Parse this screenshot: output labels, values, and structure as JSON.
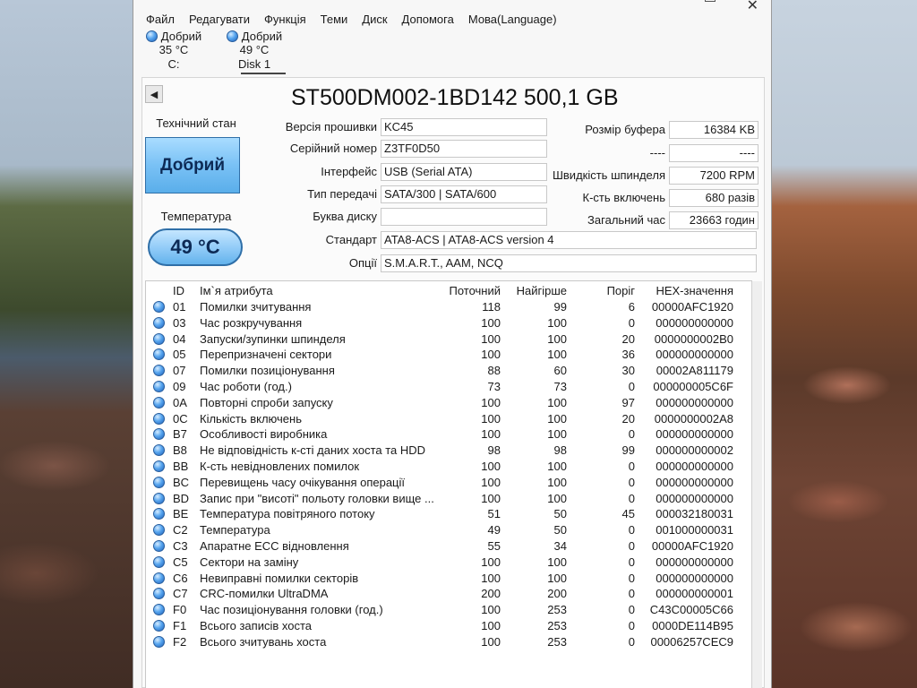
{
  "window": {
    "close_glyph": "✕"
  },
  "menu": [
    "Файл",
    "Редагувати",
    "Функція",
    "Теми",
    "Диск",
    "Допомога",
    "Мова(Language)"
  ],
  "disks": [
    {
      "status": "Добрий",
      "temp": "35 °C",
      "label": "C:"
    },
    {
      "status": "Добрий",
      "temp": "49 °C",
      "label": "Disk 1"
    }
  ],
  "disk_title": "ST500DM002-1BD142 500,1 GB",
  "health": {
    "label": "Технічний стан",
    "value": "Добрий"
  },
  "temperature": {
    "label": "Температура",
    "value": "49 °C"
  },
  "fields": {
    "firmware": {
      "label": "Версія прошивки",
      "value": "KC45"
    },
    "serial": {
      "label": "Серійний номер",
      "value": "Z3TF0D50"
    },
    "interface": {
      "label": "Інтерфейс",
      "value": "USB (Serial ATA)"
    },
    "transfer": {
      "label": "Тип передачі",
      "value": "SATA/300 | SATA/600"
    },
    "letter": {
      "label": "Буква диску",
      "value": ""
    },
    "standard": {
      "label": "Стандарт",
      "value": "ATA8-ACS | ATA8-ACS version 4"
    },
    "features": {
      "label": "Опції",
      "value": "S.M.A.R.T., AAM, NCQ"
    },
    "buffer": {
      "label": "Розмір буфера",
      "value": "16384 KB"
    },
    "blank": {
      "label": "----",
      "value": "----"
    },
    "rotation": {
      "label": "Швидкість шпинделя",
      "value": "7200 RPM"
    },
    "power_count": {
      "label": "К-сть включень",
      "value": "680 разів"
    },
    "power_hours": {
      "label": "Загальний час",
      "value": "23663 годин"
    }
  },
  "smart": {
    "headers": {
      "id": "ID",
      "name": "Ім`я атрибута",
      "current": "Поточний",
      "worst": "Найгірше",
      "threshold": "Поріг",
      "raw": "HEX-значення"
    },
    "rows": [
      {
        "id": "01",
        "name": "Помилки зчитування",
        "current": "118",
        "worst": "99",
        "threshold": "6",
        "raw": "00000AFC1920"
      },
      {
        "id": "03",
        "name": "Час розкручування",
        "current": "100",
        "worst": "100",
        "threshold": "0",
        "raw": "000000000000"
      },
      {
        "id": "04",
        "name": "Запуски/зупинки шпинделя",
        "current": "100",
        "worst": "100",
        "threshold": "20",
        "raw": "0000000002B0"
      },
      {
        "id": "05",
        "name": "Перепризначені сектори",
        "current": "100",
        "worst": "100",
        "threshold": "36",
        "raw": "000000000000"
      },
      {
        "id": "07",
        "name": "Помилки позиціонування",
        "current": "88",
        "worst": "60",
        "threshold": "30",
        "raw": "00002A811179"
      },
      {
        "id": "09",
        "name": "Час роботи (год.)",
        "current": "73",
        "worst": "73",
        "threshold": "0",
        "raw": "000000005C6F"
      },
      {
        "id": "0A",
        "name": "Повторні спроби запуску",
        "current": "100",
        "worst": "100",
        "threshold": "97",
        "raw": "000000000000"
      },
      {
        "id": "0C",
        "name": "Кількість включень",
        "current": "100",
        "worst": "100",
        "threshold": "20",
        "raw": "0000000002A8"
      },
      {
        "id": "B7",
        "name": "Особливості виробника",
        "current": "100",
        "worst": "100",
        "threshold": "0",
        "raw": "000000000000"
      },
      {
        "id": "B8",
        "name": "Не відповідність к-сті даних хоста та HDD",
        "current": "98",
        "worst": "98",
        "threshold": "99",
        "raw": "000000000002"
      },
      {
        "id": "BB",
        "name": "К-сть невідновлених помилок",
        "current": "100",
        "worst": "100",
        "threshold": "0",
        "raw": "000000000000"
      },
      {
        "id": "BC",
        "name": "Перевищень часу очікування операції",
        "current": "100",
        "worst": "100",
        "threshold": "0",
        "raw": "000000000000"
      },
      {
        "id": "BD",
        "name": "Запис при \"висоті\" польоту головки вище ...",
        "current": "100",
        "worst": "100",
        "threshold": "0",
        "raw": "000000000000"
      },
      {
        "id": "BE",
        "name": "Температура повітряного потоку",
        "current": "51",
        "worst": "50",
        "threshold": "45",
        "raw": "000032180031"
      },
      {
        "id": "C2",
        "name": "Температура",
        "current": "49",
        "worst": "50",
        "threshold": "0",
        "raw": "001000000031"
      },
      {
        "id": "C3",
        "name": "Апаратне ECC відновлення",
        "current": "55",
        "worst": "34",
        "threshold": "0",
        "raw": "00000AFC1920"
      },
      {
        "id": "C5",
        "name": "Сектори на заміну",
        "current": "100",
        "worst": "100",
        "threshold": "0",
        "raw": "000000000000"
      },
      {
        "id": "C6",
        "name": "Невиправні помилки секторів",
        "current": "100",
        "worst": "100",
        "threshold": "0",
        "raw": "000000000000"
      },
      {
        "id": "C7",
        "name": "CRC-помилки UltraDMA",
        "current": "200",
        "worst": "200",
        "threshold": "0",
        "raw": "000000000001"
      },
      {
        "id": "F0",
        "name": "Час позиціонування головки (год.)",
        "current": "100",
        "worst": "253",
        "threshold": "0",
        "raw": "C43C00005C66"
      },
      {
        "id": "F1",
        "name": "Всього записів хоста",
        "current": "100",
        "worst": "253",
        "threshold": "0",
        "raw": "0000DE114B95"
      },
      {
        "id": "F2",
        "name": "Всього зчитувань хоста",
        "current": "100",
        "worst": "253",
        "threshold": "0",
        "raw": "00006257CEC9"
      }
    ]
  }
}
